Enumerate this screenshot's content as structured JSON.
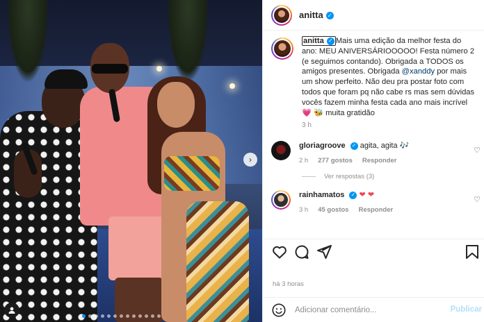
{
  "post": {
    "username": "anitta",
    "verified_icon": "verified-badge-icon",
    "caption": {
      "username": "anitta",
      "text_part1": "Mais uma edição da melhor festa do ano: MEU ANIVERSÁRIOOOOO! Festa número 2 (e seguimos contando). Obrigada a TODOS os amigos presentes. Obrigada ",
      "mention": "@xanddy",
      "text_part2": " por mais um show perfeito. Não deu pra postar foto com todos que foram pq não cabe rs mas sem dúvidas vocês fazem minha festa cada ano mais incrível ",
      "emoji_heart": "💗",
      "emoji_extra": "🐝",
      "text_part3": " muita gratidão",
      "time": "3 h"
    },
    "comments": [
      {
        "username": "gloriagroove",
        "text": "agita, agita 🎶",
        "time": "2 h",
        "likes": "277 gostos",
        "reply_label": "Responder",
        "view_replies": "Ver respostas (3)"
      },
      {
        "username": "rainhamatos",
        "text": "❤",
        "text2": "❤",
        "time": "3 h",
        "likes": "45 gostos",
        "reply_label": "Responder"
      }
    ],
    "timestamp": "há 3 horas",
    "add_comment_placeholder": "Adicionar comentário...",
    "publish_label": "Publicar"
  },
  "colors": {
    "link": "#00376b",
    "verified": "#0095f6",
    "muted": "#8e8e8e",
    "publish_disabled": "#b2dffc"
  }
}
